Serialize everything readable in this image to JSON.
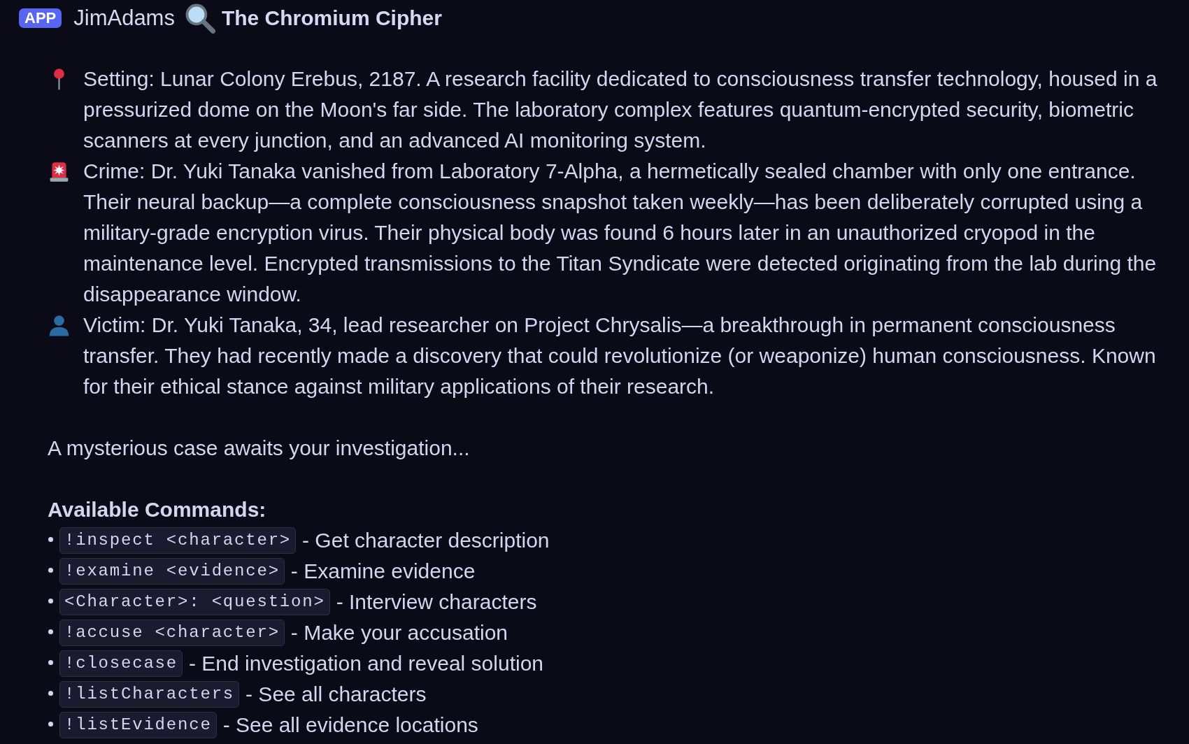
{
  "message": {
    "tag": "APP",
    "author": "JimAdams",
    "title": "The Chromium Cipher"
  },
  "case_details": [
    {
      "kind": "setting",
      "text": "Setting: Lunar Colony Erebus, 2187. A research facility dedicated to consciousness transfer technology, housed in a pressurized dome on the Moon's far side. The laboratory complex features quantum-encrypted security, biometric scanners at every junction, and an advanced AI monitoring system."
    },
    {
      "kind": "crime",
      "text": "Crime: Dr. Yuki Tanaka vanished from Laboratory 7-Alpha, a hermetically sealed chamber with only one entrance. Their neural backup—a complete consciousness snapshot taken weekly—has been deliberately corrupted using a military-grade encryption virus. Their physical body was found 6 hours later in an unauthorized cryopod in the maintenance level. Encrypted transmissions to the Titan Syndicate were detected originating from the lab during the disappearance window."
    },
    {
      "kind": "victim",
      "text": "Victim: Dr. Yuki Tanaka, 34, lead researcher on Project Chrysalis—a breakthrough in permanent consciousness transfer. They had recently made a discovery that could revolutionize (or weaponize) human consciousness. Known for their ethical stance against military applications of their research."
    }
  ],
  "teaser": "A mysterious case awaits your investigation...",
  "commands": {
    "heading": "Available Commands:",
    "items": [
      {
        "code": "!inspect <character>",
        "description": "- Get character description"
      },
      {
        "code": "!examine <evidence>",
        "description": "- Examine evidence"
      },
      {
        "code": "<Character>: <question>",
        "description": "- Interview characters"
      },
      {
        "code": "!accuse <character>",
        "description": "- Make your accusation"
      },
      {
        "code": "!closecase",
        "description": "- End investigation and reveal solution"
      },
      {
        "code": "!listCharacters",
        "description": "- See all characters"
      },
      {
        "code": "!listEvidence",
        "description": "- See all evidence locations"
      }
    ]
  }
}
